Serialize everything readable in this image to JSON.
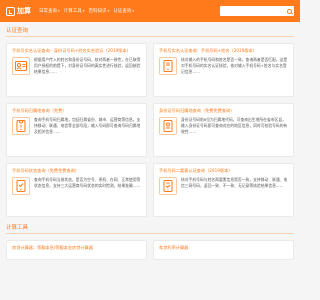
{
  "header": {
    "logo_text": "加算",
    "nav": [
      {
        "label": "日常查询"
      },
      {
        "label": "计算工具"
      },
      {
        "label": "百科知识"
      },
      {
        "label": "认证查询"
      }
    ]
  },
  "sections": [
    {
      "title": "认证查询"
    }
  ],
  "cards": [
    {
      "title": "手机号实名认证查询 - 身份证号码+姓名实名验证（2019版本）",
      "text": "根据用户传入的姓名和身份证号码，核对两者一致性，在已取得用户授权的前提下，对身份证号码的真实性进行核验，返回核验结果信息……",
      "icon": "id-card-icon"
    },
    {
      "title": "手机号实名认证查询：手机号码+姓名（2019版本）",
      "text": "核对输入的手机号码和姓名是否一致，查询两者是否匹配。这是对手机号码的实名认证核验，核对输入手机号码+姓名与实名登记信息……",
      "icon": "phone-card-icon"
    },
    {
      "title": "手机号码归属地查询（免费）",
      "text": "查询手机号码归属地，包括归属省份、城市、运营商等信息。支持移动、联通、电信等全部号段，输入号码即可查询号码归属地及相关信息……",
      "icon": "location-phone-icon"
    },
    {
      "title": "身份证号码归属地查询（免费免费查询）",
      "text": "身份证号码前6位为归属地代码，可查询出生地所在省市区县，输入身份证号码即可查询对应的地区信息，同时可校验号码的有效性……",
      "icon": "id-location-icon"
    },
    {
      "title": "手机号码状态查询（免费免费查询）",
      "text": "查询手机号码当前状态，是否为空号、停机、在网、正常使用等状态信息，支持三大运营商号码状态的实时检测，结果准确……",
      "icon": "phone-status-icon"
    },
    {
      "title": "手机号码二要素认证查询（2019版本）",
      "text": "核对手机号码与姓名两要素信息是否一致，支持移动、联通、电信三网号码，返回一致、不一致、无记录等核验结果信息……",
      "icon": "phone-verify-icon"
    }
  ],
  "section2": {
    "title": "计算工具"
  },
  "bottom_cards": [
    {
      "title": "房贷计算器：等额本息/等额本金房贷计算器"
    },
    {
      "title": "车贷利率计算器"
    }
  ]
}
